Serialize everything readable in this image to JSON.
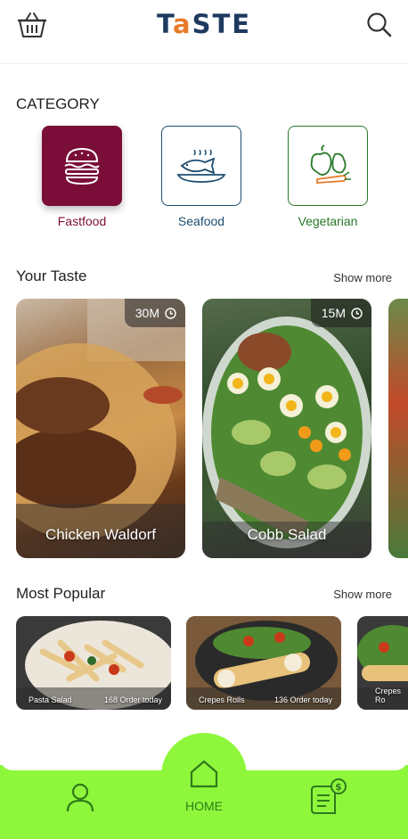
{
  "header": {
    "logo_prefix": "T",
    "logo_accent": "a",
    "logo_suffix": "STE"
  },
  "category": {
    "title": "CATEGORY",
    "items": [
      {
        "label": "Fastfood",
        "icon": "burger-icon",
        "color": "#7a0e38"
      },
      {
        "label": "Seafood",
        "icon": "fish-platter-icon",
        "color": "#1e4d70"
      },
      {
        "label": "Vegetarian",
        "icon": "vegetables-icon",
        "color": "#2a7a2a"
      }
    ]
  },
  "your_taste": {
    "title": "Your Taste",
    "show_more": "Show more",
    "cards": [
      {
        "name": "Chicken Waldorf",
        "time": "30M"
      },
      {
        "name": "Cobb Salad",
        "time": "15M"
      }
    ]
  },
  "most_popular": {
    "title": "Most Popular",
    "show_more": "Show more",
    "cards": [
      {
        "name": "Pasta Salad",
        "orders": "168 Order today"
      },
      {
        "name": "Crepes Rolls",
        "orders": "136 Order today"
      },
      {
        "name": "Crepes Ro",
        "orders": ""
      }
    ]
  },
  "bottom_nav": {
    "home_label": "HOME"
  },
  "colors": {
    "accent_green": "#8ef73c",
    "logo_blue": "#1e3a5f",
    "logo_orange": "#e87b2a"
  }
}
